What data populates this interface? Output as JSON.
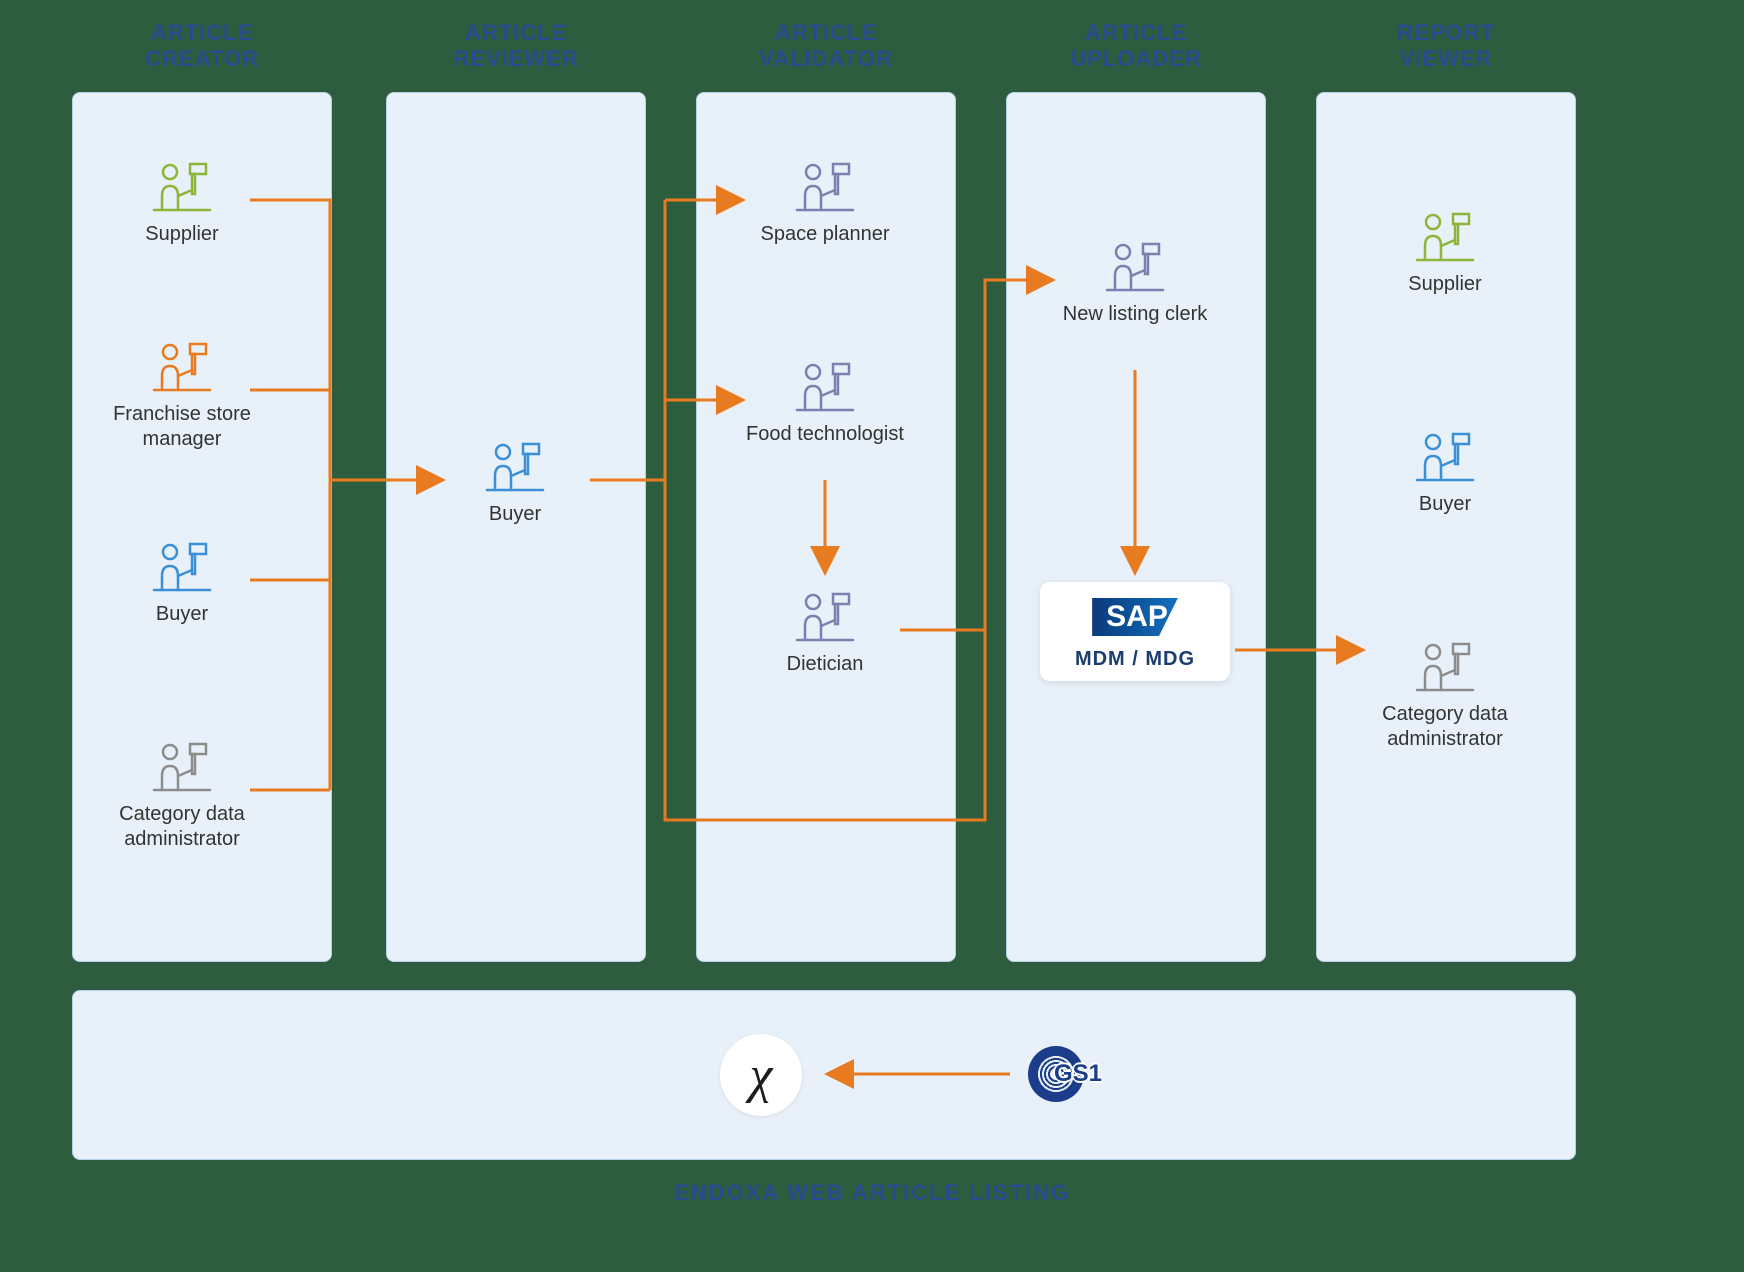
{
  "columns": [
    {
      "title": "ARTICLE CREATOR"
    },
    {
      "title": "ARTICLE REVIEWER"
    },
    {
      "title": "ARTICLE VALIDATOR"
    },
    {
      "title": "ARTICLE UPLOADER"
    },
    {
      "title": "REPORT VIEWER"
    }
  ],
  "creator": {
    "roles": [
      "Supplier",
      "Franchise store manager",
      "Buyer",
      "Category data administrator"
    ]
  },
  "reviewer": {
    "roles": [
      "Buyer"
    ]
  },
  "validator": {
    "roles": [
      "Space planner",
      "Food technologist",
      "Dietician"
    ]
  },
  "uploader": {
    "role": "New listing clerk",
    "system": {
      "brand": "SAP",
      "subtitle": "MDM / MDG"
    }
  },
  "report_viewer": {
    "roles": [
      "Supplier",
      "Buyer",
      "Category data administrator"
    ]
  },
  "footer": {
    "title": "ENDOXA WEB ARTICLE LISTING",
    "chi_label": "χ",
    "gs1_label": "GS1"
  }
}
